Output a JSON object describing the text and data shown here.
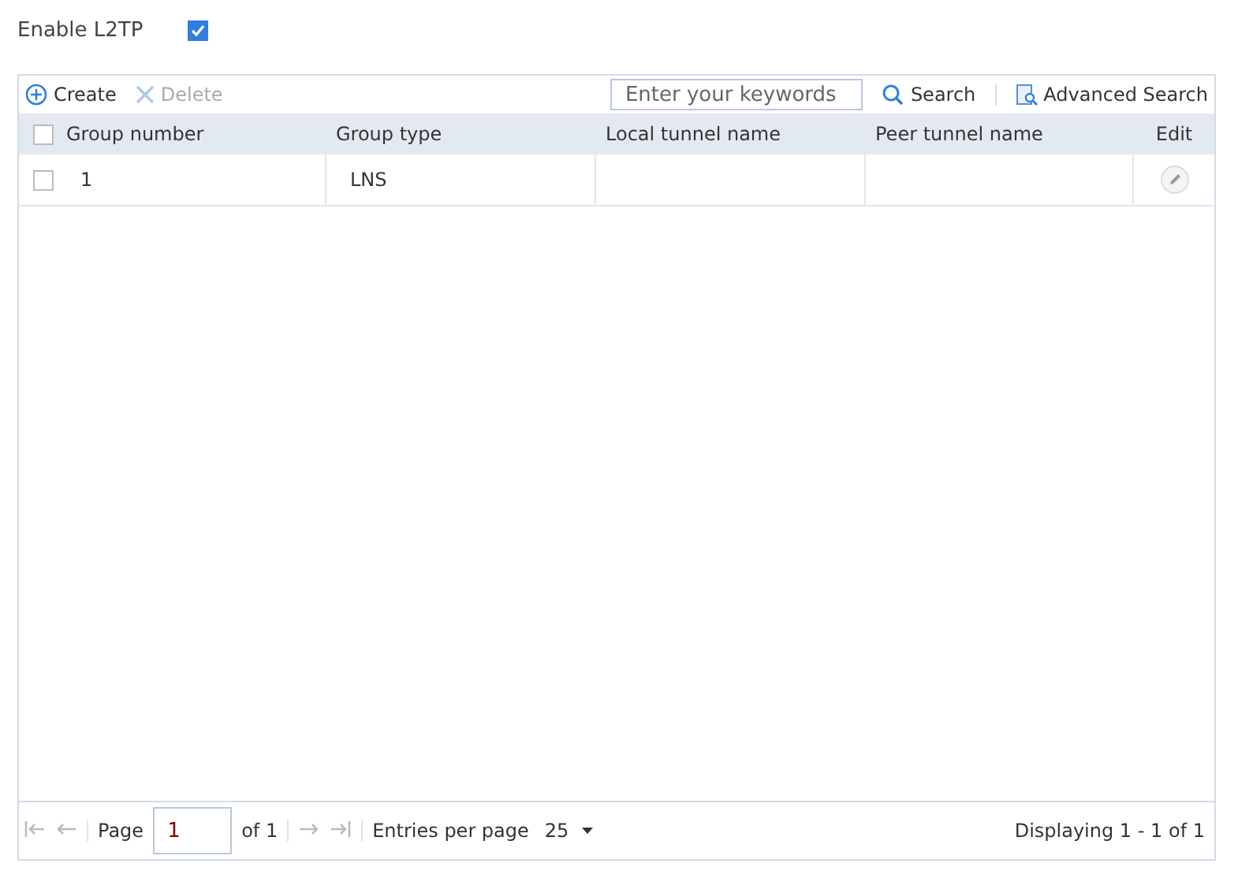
{
  "enable_l2tp": {
    "label": "Enable L2TP",
    "checked": true
  },
  "toolbar": {
    "buttons": [
      {
        "kind": "create",
        "label": "Create",
        "disabled": false
      },
      {
        "kind": "delete",
        "label": "Delete",
        "disabled": true
      }
    ],
    "search": {
      "placeholder": "Enter your keywords",
      "button": "Search",
      "advanced": "Advanced Search"
    }
  },
  "table": {
    "select_all": {
      "checked": false
    },
    "columns": [
      "Group number",
      "Group type",
      "Local tunnel name",
      "Peer tunnel name",
      "Edit"
    ],
    "rows": [
      {
        "checked": false,
        "cells": [
          "1",
          "LNS",
          "",
          ""
        ]
      }
    ]
  },
  "pagination": {
    "page_label": "Page",
    "page": "1",
    "of": "of 1",
    "entries_label": "Entries per page",
    "entries": "25",
    "displaying": "Displaying 1 - 1 of 1"
  }
}
